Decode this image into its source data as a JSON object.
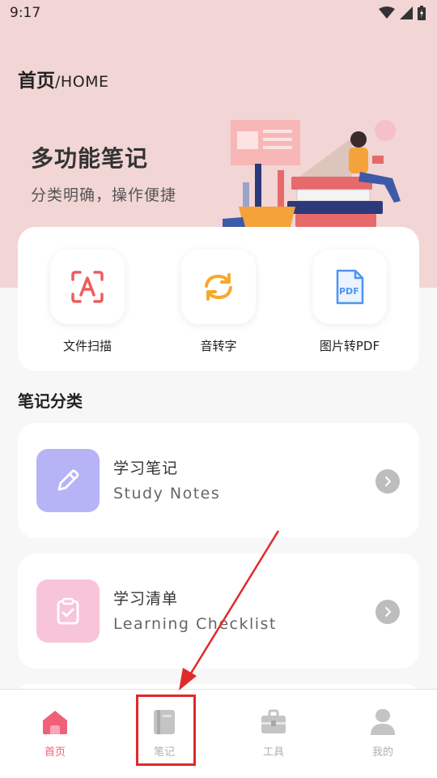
{
  "status_bar": {
    "time": "9:17"
  },
  "header": {
    "title_cn": "首页",
    "title_sep": "/",
    "title_en": "HOME"
  },
  "hero": {
    "title": "多功能笔记",
    "subtitle": "分类明确，操作便捷"
  },
  "tools": [
    {
      "label": "文件扫描",
      "icon": "scan-text-icon"
    },
    {
      "label": "音转字",
      "icon": "sync-convert-icon"
    },
    {
      "label": "图片转PDF",
      "icon": "pdf-file-icon"
    }
  ],
  "section_title": "笔记分类",
  "categories": [
    {
      "title": "学习笔记",
      "subtitle": "Study Notes",
      "icon": "pencil-icon",
      "color": "#b7b3f7"
    },
    {
      "title": "学习清单",
      "subtitle": "Learning Checklist",
      "icon": "clipboard-check-icon",
      "color": "#f8c4da"
    }
  ],
  "bottom_nav": [
    {
      "label": "首页",
      "icon": "home-icon",
      "active": true
    },
    {
      "label": "笔记",
      "icon": "notebook-icon",
      "active": false
    },
    {
      "label": "工具",
      "icon": "toolbox-icon",
      "active": false
    },
    {
      "label": "我的",
      "icon": "profile-icon",
      "active": false
    }
  ],
  "colors": {
    "hero_bg": "#f2d5d5",
    "accent": "#f0607a",
    "annotation": "#e02a2a"
  }
}
